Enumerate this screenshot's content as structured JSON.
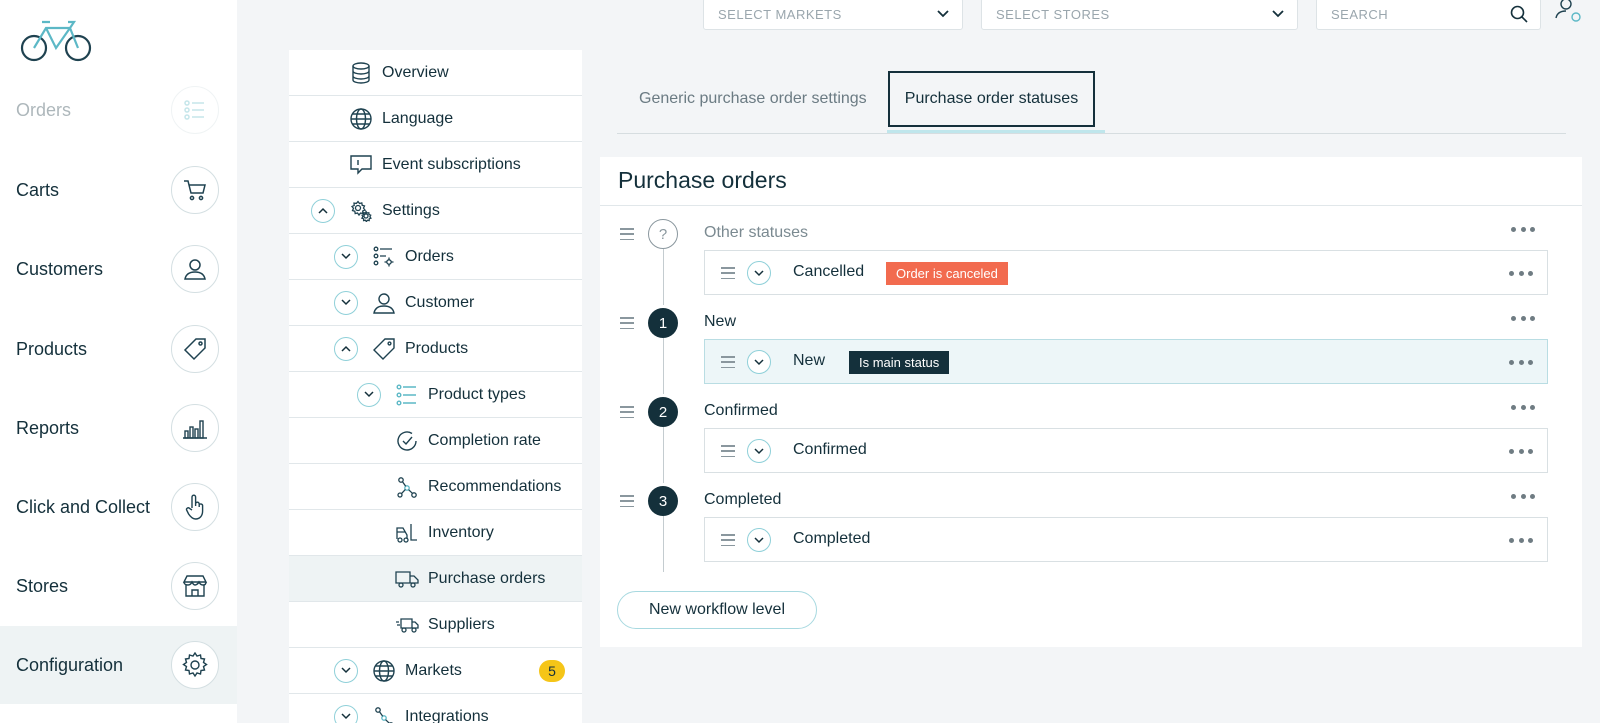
{
  "sidebar": {
    "items": [
      {
        "label": "Orders",
        "icon": "list-icon"
      },
      {
        "label": "Carts",
        "icon": "cart-icon"
      },
      {
        "label": "Customers",
        "icon": "user-icon"
      },
      {
        "label": "Products",
        "icon": "tag-icon"
      },
      {
        "label": "Reports",
        "icon": "bar-chart-icon"
      },
      {
        "label": "Click and Collect",
        "icon": "hand-pointer-icon"
      },
      {
        "label": "Stores",
        "icon": "store-icon"
      },
      {
        "label": "Configuration",
        "icon": "gear-icon"
      }
    ]
  },
  "topbar": {
    "markets_placeholder": "SELECT MARKETS",
    "stores_placeholder": "SELECT STORES",
    "search_placeholder": "SEARCH"
  },
  "tree": {
    "overview": "Overview",
    "language": "Language",
    "event_subscriptions": "Event subscriptions",
    "settings": "Settings",
    "orders": "Orders",
    "customer": "Customer",
    "products": "Products",
    "product_types": "Product types",
    "completion_rate": "Completion rate",
    "recommendations": "Recommendations",
    "inventory": "Inventory",
    "purchase_orders": "Purchase orders",
    "suppliers": "Suppliers",
    "markets": "Markets",
    "markets_count": "5",
    "integrations": "Integrations"
  },
  "tabs": {
    "generic": "Generic purchase order settings",
    "statuses": "Purchase order statuses"
  },
  "card": {
    "title": "Purchase orders",
    "levels": [
      {
        "marker": "?",
        "name": "Other statuses",
        "status": "Cancelled",
        "tag": "Order is canceled",
        "tag_color": "#f26b4f"
      },
      {
        "marker": "1",
        "name": "New",
        "status": "New",
        "tag": "Is main status",
        "tag_color": "#14303b"
      },
      {
        "marker": "2",
        "name": "Confirmed",
        "status": "Confirmed"
      },
      {
        "marker": "3",
        "name": "Completed",
        "status": "Completed"
      }
    ],
    "new_level_button": "New workflow level"
  },
  "colors": {
    "primary_dark": "#14303b",
    "accent_teal": "#8fd0d9",
    "warning_tag": "#f26b4f",
    "badge_yellow": "#f5c518"
  }
}
